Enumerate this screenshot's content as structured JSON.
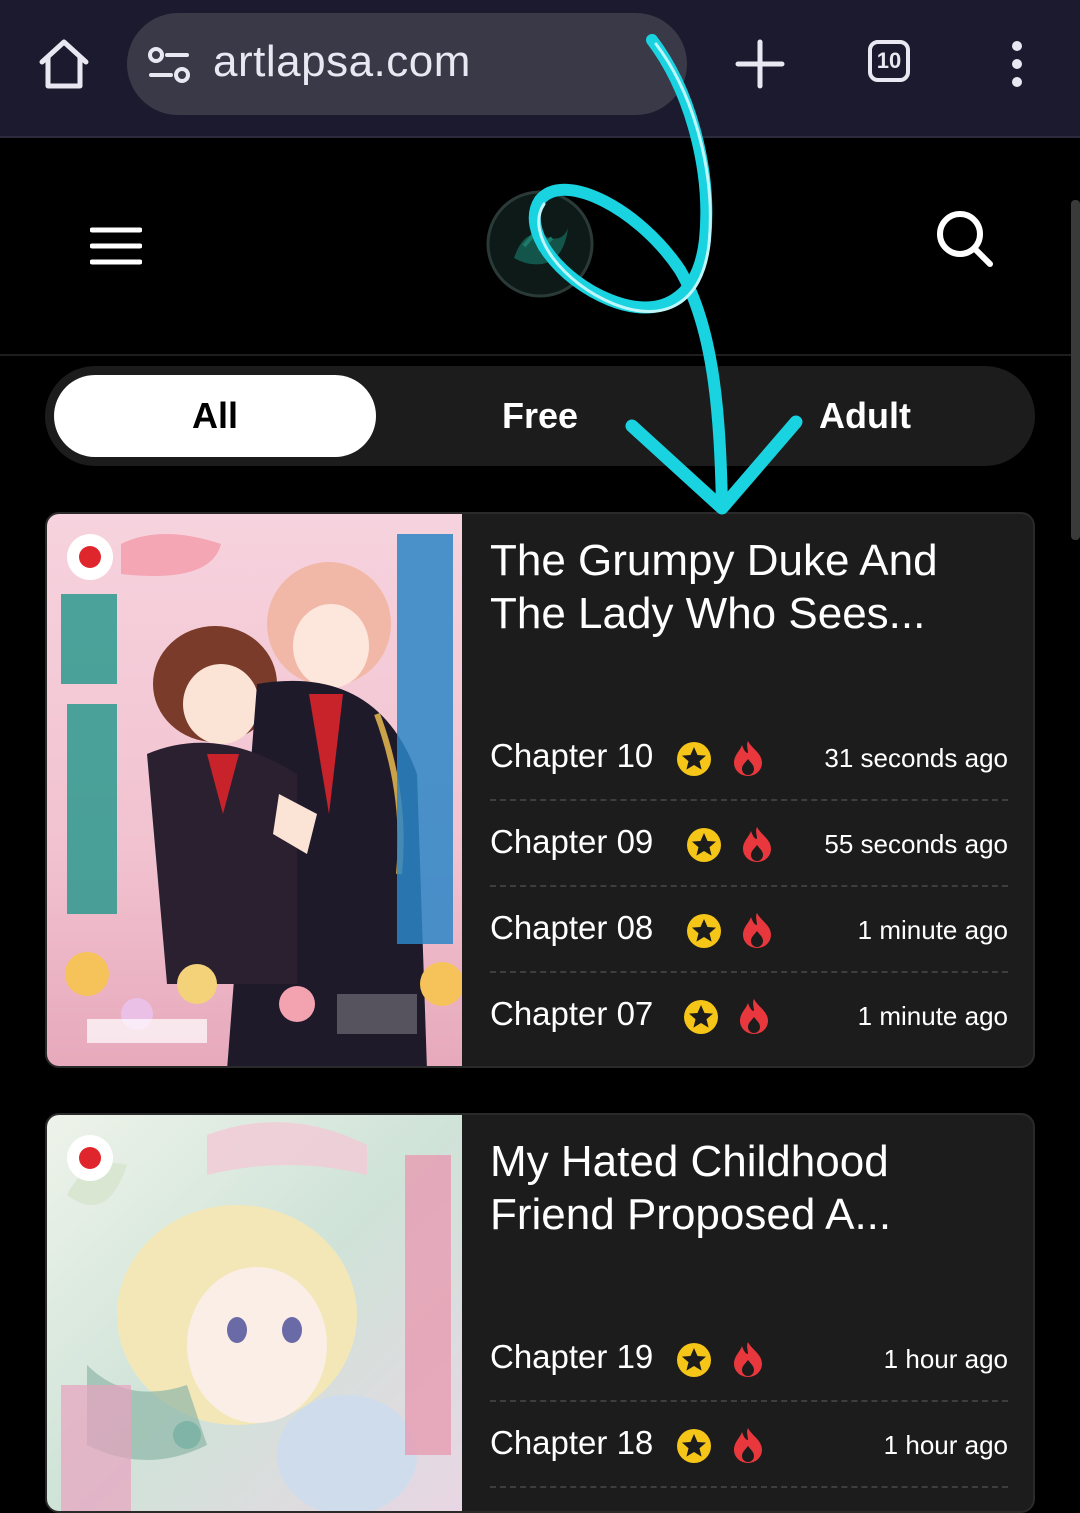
{
  "browser": {
    "url": "artlapsa.com",
    "tab_count": "10",
    "icons": [
      "home-icon",
      "site-info-icon",
      "plus-icon",
      "tab-switcher-icon",
      "kebab-menu-icon"
    ]
  },
  "header": {
    "icons": [
      "hamburger-menu-icon",
      "site-logo",
      "search-icon"
    ]
  },
  "filters": {
    "tabs": [
      {
        "label": "All",
        "active": true
      },
      {
        "label": "Free",
        "active": false
      },
      {
        "label": "Adult",
        "active": false
      }
    ]
  },
  "cards": [
    {
      "title": "The Grumpy Duke And The Lady Who Sees...",
      "chapters": [
        {
          "name": "Chapter 10",
          "time": "31 seconds ago"
        },
        {
          "name": "Chapter 09",
          "time": "55 seconds ago"
        },
        {
          "name": "Chapter 08",
          "time": "1 minute ago"
        },
        {
          "name": "Chapter 07",
          "time": "1 minute ago"
        }
      ]
    },
    {
      "title": "My Hated Childhood Friend Proposed A...",
      "chapters": [
        {
          "name": "Chapter 19",
          "time": "1 hour ago"
        },
        {
          "name": "Chapter 18",
          "time": "1 hour ago"
        }
      ]
    }
  ],
  "colors": {
    "browser_bar": "#1b1a2e",
    "card_bg": "#1c1c1c",
    "annotation_arrow": "#19d3e0",
    "star": "#f5c518",
    "fire": "#e8383d"
  }
}
